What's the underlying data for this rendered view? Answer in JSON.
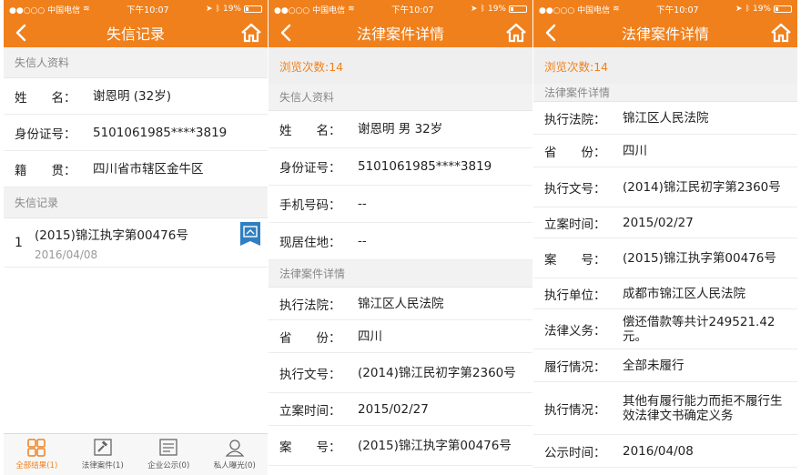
{
  "status_bar": {
    "carrier": "●●○○○ 中国电信",
    "time": "下午10:07",
    "battery": "19%",
    "battery_fraction": 0.19
  },
  "screen1": {
    "nav_title": "失信记录",
    "profile_header": "失信人资料",
    "profile_rows": [
      {
        "label": "姓　　名：",
        "value": "谢恩明 (32岁)"
      },
      {
        "label": "身份证号：",
        "value": "5101061985****3819"
      },
      {
        "label": "籍　　贯：",
        "value": "四川省市辖区金牛区"
      }
    ],
    "records_header": "失信记录",
    "records": [
      {
        "index": "1",
        "title": "(2015)锦江执字第00476号",
        "date": "2016/04/08"
      }
    ],
    "tabs": [
      {
        "label": "全部结果(1)",
        "icon": "grid-icon",
        "active": true
      },
      {
        "label": "法律案件(1)",
        "icon": "gavel-icon",
        "active": false
      },
      {
        "label": "企业公示(0)",
        "icon": "notice-icon",
        "active": false
      },
      {
        "label": "私人曝光(0)",
        "icon": "person-icon",
        "active": false
      }
    ]
  },
  "screen2": {
    "nav_title": "法律案件详情",
    "views": "浏览次数:14",
    "profile_header": "失信人资料",
    "profile_rows": [
      {
        "label": "姓　　名：",
        "value": "谢恩明  男  32岁"
      },
      {
        "label": "身份证号：",
        "value": "5101061985****3819"
      },
      {
        "label": "手机号码：",
        "value": "--"
      },
      {
        "label": "现居住地：",
        "value": "--"
      }
    ],
    "case_header": "法律案件详情",
    "case_rows": [
      {
        "label": "执行法院：",
        "value": "锦江区人民法院"
      },
      {
        "label": "省　　份：",
        "value": "四川"
      },
      {
        "label": "执行文号：",
        "value": "(2014)锦江民初字第2360号"
      },
      {
        "label": "立案时间：",
        "value": "2015/02/27"
      },
      {
        "label": "案　　号：",
        "value": "(2015)锦江执字第00476号"
      }
    ]
  },
  "screen3": {
    "nav_title": "法律案件详情",
    "views": "浏览次数:14",
    "case_header": "法律案件详情",
    "case_rows": [
      {
        "label": "执行法院：",
        "value": "锦江区人民法院"
      },
      {
        "label": "省　　份：",
        "value": "四川"
      },
      {
        "label": "执行文号：",
        "value": "(2014)锦江民初字第2360号"
      },
      {
        "label": "立案时间：",
        "value": "2015/02/27"
      },
      {
        "label": "案　　号：",
        "value": "(2015)锦江执字第00476号"
      },
      {
        "label": "执行单位：",
        "value": "成都市锦江区人民法院"
      },
      {
        "label": "法律义务：",
        "value": "偿还借款等共计249521.42元。"
      },
      {
        "label": "履行情况：",
        "value": "全部未履行"
      },
      {
        "label": "执行情况：",
        "value": "其他有履行能力而拒不履行生效法律文书确定义务"
      },
      {
        "label": "公示时间：",
        "value": "2016/04/08"
      }
    ]
  },
  "colors": {
    "brand": "#f0801c",
    "badge": "#2f7fc1"
  }
}
